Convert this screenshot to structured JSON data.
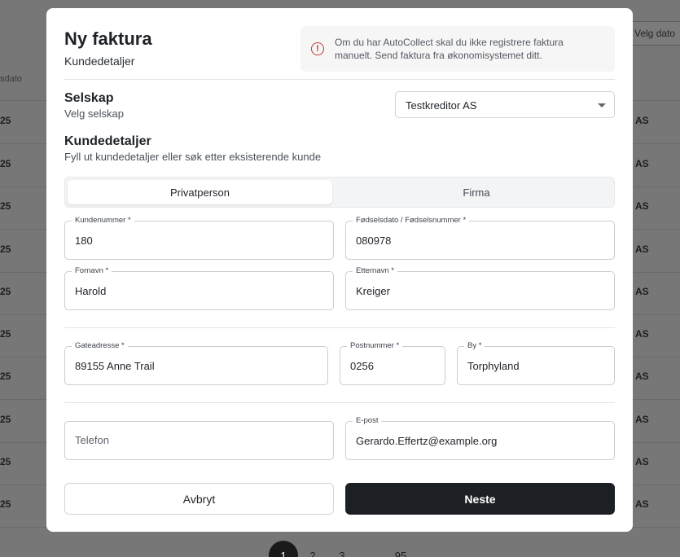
{
  "background": {
    "header_cell": "sdato",
    "right_button": "Velg dato",
    "row_left_text": "25",
    "row_right_text": "AS",
    "pagination": [
      "1",
      "2",
      "3",
      "...",
      "95"
    ]
  },
  "modal": {
    "title": "Ny faktura",
    "subtitle": "Kundedetaljer",
    "notice": "Om du har AutoCollect skal du ikke registrere faktura manuelt. Send faktura fra økonomisystemet ditt.",
    "company_section": {
      "title": "Selskap",
      "subtitle": "Velg selskap",
      "selected": "Testkreditor AS"
    },
    "customer_section": {
      "title": "Kundedetaljer",
      "subtitle": "Fyll ut kundedetaljer eller søk etter eksisterende kunde"
    },
    "tabs": [
      {
        "label": "Privatperson",
        "active": true
      },
      {
        "label": "Firma",
        "active": false
      }
    ],
    "fields": {
      "customer_number": {
        "label": "Kundenummer *",
        "value": "180"
      },
      "birth_date": {
        "label": "Fødselsdato / Fødselsnummer *",
        "value": "080978"
      },
      "first_name": {
        "label": "Fornavn *",
        "value": "Harold"
      },
      "last_name": {
        "label": "Etternavn *",
        "value": "Kreiger"
      },
      "street": {
        "label": "Gateadresse *",
        "value": "89155 Anne Trail"
      },
      "postal_code": {
        "label": "Postnummer *",
        "value": "0256"
      },
      "city": {
        "label": "By *",
        "value": "Torphyland"
      },
      "phone": {
        "placeholder": "Telefon",
        "value": ""
      },
      "email": {
        "label": "E-post",
        "value": "Gerardo.Effertz@example.org"
      }
    },
    "buttons": {
      "cancel": "Avbryt",
      "next": "Neste"
    }
  },
  "colors": {
    "primary_button": "#1c1f24",
    "notice_icon": "#c0392b",
    "overlay": "#777777"
  },
  "icons": {
    "notice": "alert-circle-icon",
    "select": "chevron-down-icon"
  }
}
